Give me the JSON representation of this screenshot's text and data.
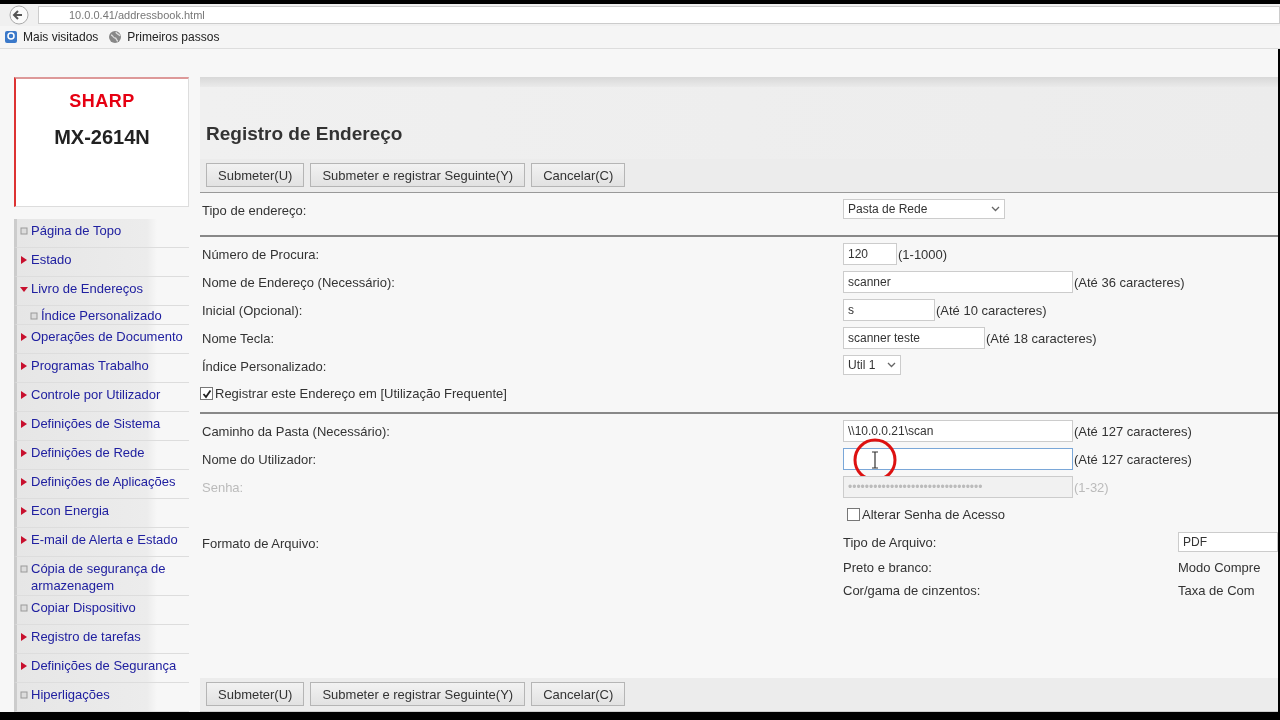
{
  "browser": {
    "url": "10.0.0.41/addressbook.html",
    "bookmarks": [
      {
        "label": "Mais visitados",
        "kind": "bookmarks"
      },
      {
        "label": "Primeiros passos",
        "kind": "globe"
      }
    ]
  },
  "sidebar": {
    "brand": "SHARP",
    "model": "MX-2614N",
    "items": [
      {
        "label": "Página de Topo",
        "kind": "page"
      },
      {
        "label": "Estado",
        "kind": "folder",
        "expanded": false
      },
      {
        "label": "Livro de Endereços",
        "kind": "folder",
        "expanded": true,
        "children": [
          {
            "label": "Índice Personalizado",
            "kind": "page"
          }
        ]
      },
      {
        "label": "Operações de Documento",
        "kind": "folder",
        "expanded": false
      },
      {
        "label": "Programas Trabalho",
        "kind": "folder",
        "expanded": false
      },
      {
        "label": "Controle por Utilizador",
        "kind": "folder",
        "expanded": false
      },
      {
        "label": "Definições de Sistema",
        "kind": "folder",
        "expanded": false
      },
      {
        "label": "Definições de Rede",
        "kind": "folder",
        "expanded": false
      },
      {
        "label": "Definições de Aplicações",
        "kind": "folder",
        "expanded": false
      },
      {
        "label": "Econ Energia",
        "kind": "folder",
        "expanded": false
      },
      {
        "label": "E-mail de Alerta e Estado",
        "kind": "folder",
        "expanded": false
      },
      {
        "label": "Cópia de segurança de armazenagem",
        "kind": "page"
      },
      {
        "label": "Copiar Dispositivo",
        "kind": "page"
      },
      {
        "label": "Registro de tarefas",
        "kind": "folder",
        "expanded": false
      },
      {
        "label": "Definições de Segurança",
        "kind": "folder",
        "expanded": false
      },
      {
        "label": "Hiperligações",
        "kind": "page"
      }
    ]
  },
  "page": {
    "title": "Registro de Endereço",
    "buttons_top": [
      "Submeter(U)",
      "Submeter e registrar Seguinte(Y)",
      "Cancelar(C)"
    ],
    "sections": [
      {
        "rows": [
          {
            "kind": "select",
            "label": "Tipo de endereço:",
            "value": "Pasta de Rede"
          }
        ]
      },
      {
        "rows": [
          {
            "kind": "text",
            "label": "Número de Procura:",
            "value": "120",
            "hint": "(1-1000)"
          },
          {
            "kind": "text",
            "label": "Nome de Endereço (Necessário):",
            "value": "scanner",
            "hint": "(Até 36 caracteres)"
          },
          {
            "kind": "text",
            "label": "Inicial (Opcional):",
            "value": "s",
            "hint": "(Até 10 caracteres)"
          },
          {
            "kind": "text",
            "label": "Nome Tecla:",
            "value": "scanner teste",
            "hint": "(Até 18 caracteres)"
          },
          {
            "kind": "select",
            "label": "Índice Personalizado:",
            "value": "Util 1"
          },
          {
            "kind": "check",
            "label": "Registrar este Endereço em [Utilização Frequente]",
            "checked": true
          }
        ]
      },
      {
        "rows": [
          {
            "kind": "text",
            "label": "Caminho da Pasta (Necessário):",
            "value": "\\\\10.0.0.21\\scan",
            "hint": "(Até 127 caracteres)"
          },
          {
            "kind": "text",
            "label": "Nome do Utilizador:",
            "value": "",
            "hint": "(Até 127 caracteres)",
            "focused": true
          },
          {
            "kind": "text",
            "label": "Senha:",
            "value": "••••••••••••••••••••••••••••••••",
            "hint": "(1-32)",
            "disabled": true
          },
          {
            "kind": "subcheck",
            "label": "Alterar Senha de Acesso",
            "checked": false
          },
          {
            "kind": "format",
            "label": "Formato de Arquivo:",
            "items": [
              {
                "label": "Tipo de Arquivo:",
                "value": "PDF",
                "kind": "select"
              },
              {
                "label": "Preto e branco:",
                "value": "Modo Compre",
                "kind": "text"
              },
              {
                "label": "Cor/gama de cinzentos:",
                "value": "Taxa de Com",
                "kind": "text"
              }
            ]
          }
        ]
      }
    ],
    "buttons_bottom": [
      "Submeter(U)",
      "Submeter e registrar Seguinte(Y)",
      "Cancelar(C)"
    ]
  }
}
